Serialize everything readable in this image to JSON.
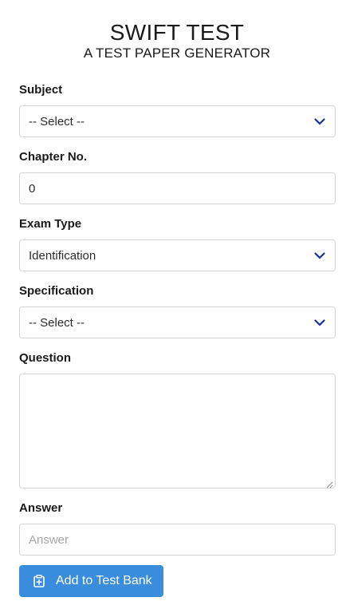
{
  "header": {
    "title": "SWIFT TEST",
    "subtitle": "A TEST PAPER GENERATOR"
  },
  "form": {
    "subject": {
      "label": "Subject",
      "value": "-- Select --"
    },
    "chapter": {
      "label": "Chapter No.",
      "value": "0"
    },
    "exam_type": {
      "label": "Exam Type",
      "value": "Identification"
    },
    "specification": {
      "label": "Specification",
      "value": "-- Select --"
    },
    "question": {
      "label": "Question",
      "value": ""
    },
    "answer": {
      "label": "Answer",
      "value": "",
      "placeholder": "Answer"
    },
    "submit": {
      "label": "Add to Test Bank",
      "icon": "clipboard-plus-icon"
    }
  },
  "colors": {
    "accent": "#3a8ddc",
    "chevron": "#1a2fa0",
    "border": "#d0d4d9"
  }
}
